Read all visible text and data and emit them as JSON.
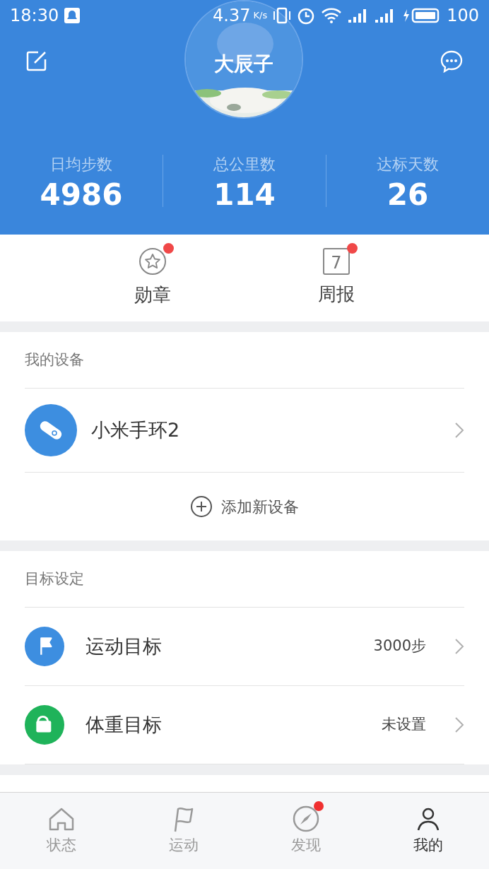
{
  "status_bar": {
    "time": "18:30",
    "speed": "4.37",
    "speed_unit": "K/s",
    "battery": "100"
  },
  "profile": {
    "name": "大辰子"
  },
  "stats": [
    {
      "label": "日均步数",
      "value": "4986"
    },
    {
      "label": "总公里数",
      "value": "114"
    },
    {
      "label": "达标天数",
      "value": "26"
    }
  ],
  "shortcuts": [
    {
      "kind": "medal",
      "label": "勋章",
      "unread": true
    },
    {
      "kind": "calendar",
      "label": "周报",
      "icon_text": "7",
      "unread": true
    }
  ],
  "devices": {
    "title": "我的设备",
    "items": [
      {
        "name": "小米手环2"
      }
    ],
    "add_label": "添加新设备"
  },
  "goals": {
    "title": "目标设定",
    "items": [
      {
        "kind": "steps",
        "label": "运动目标",
        "value": "3000步",
        "color": "#3d8ee0"
      },
      {
        "kind": "weight",
        "label": "体重目标",
        "value": "未设置",
        "color": "#1fb35a"
      }
    ]
  },
  "tabs": [
    {
      "kind": "home",
      "label": "状态",
      "selected": false,
      "unread": false
    },
    {
      "kind": "flag",
      "label": "运动",
      "selected": false,
      "unread": false
    },
    {
      "kind": "compass",
      "label": "发现",
      "selected": false,
      "unread": true
    },
    {
      "kind": "person",
      "label": "我的",
      "selected": true,
      "unread": false
    }
  ]
}
